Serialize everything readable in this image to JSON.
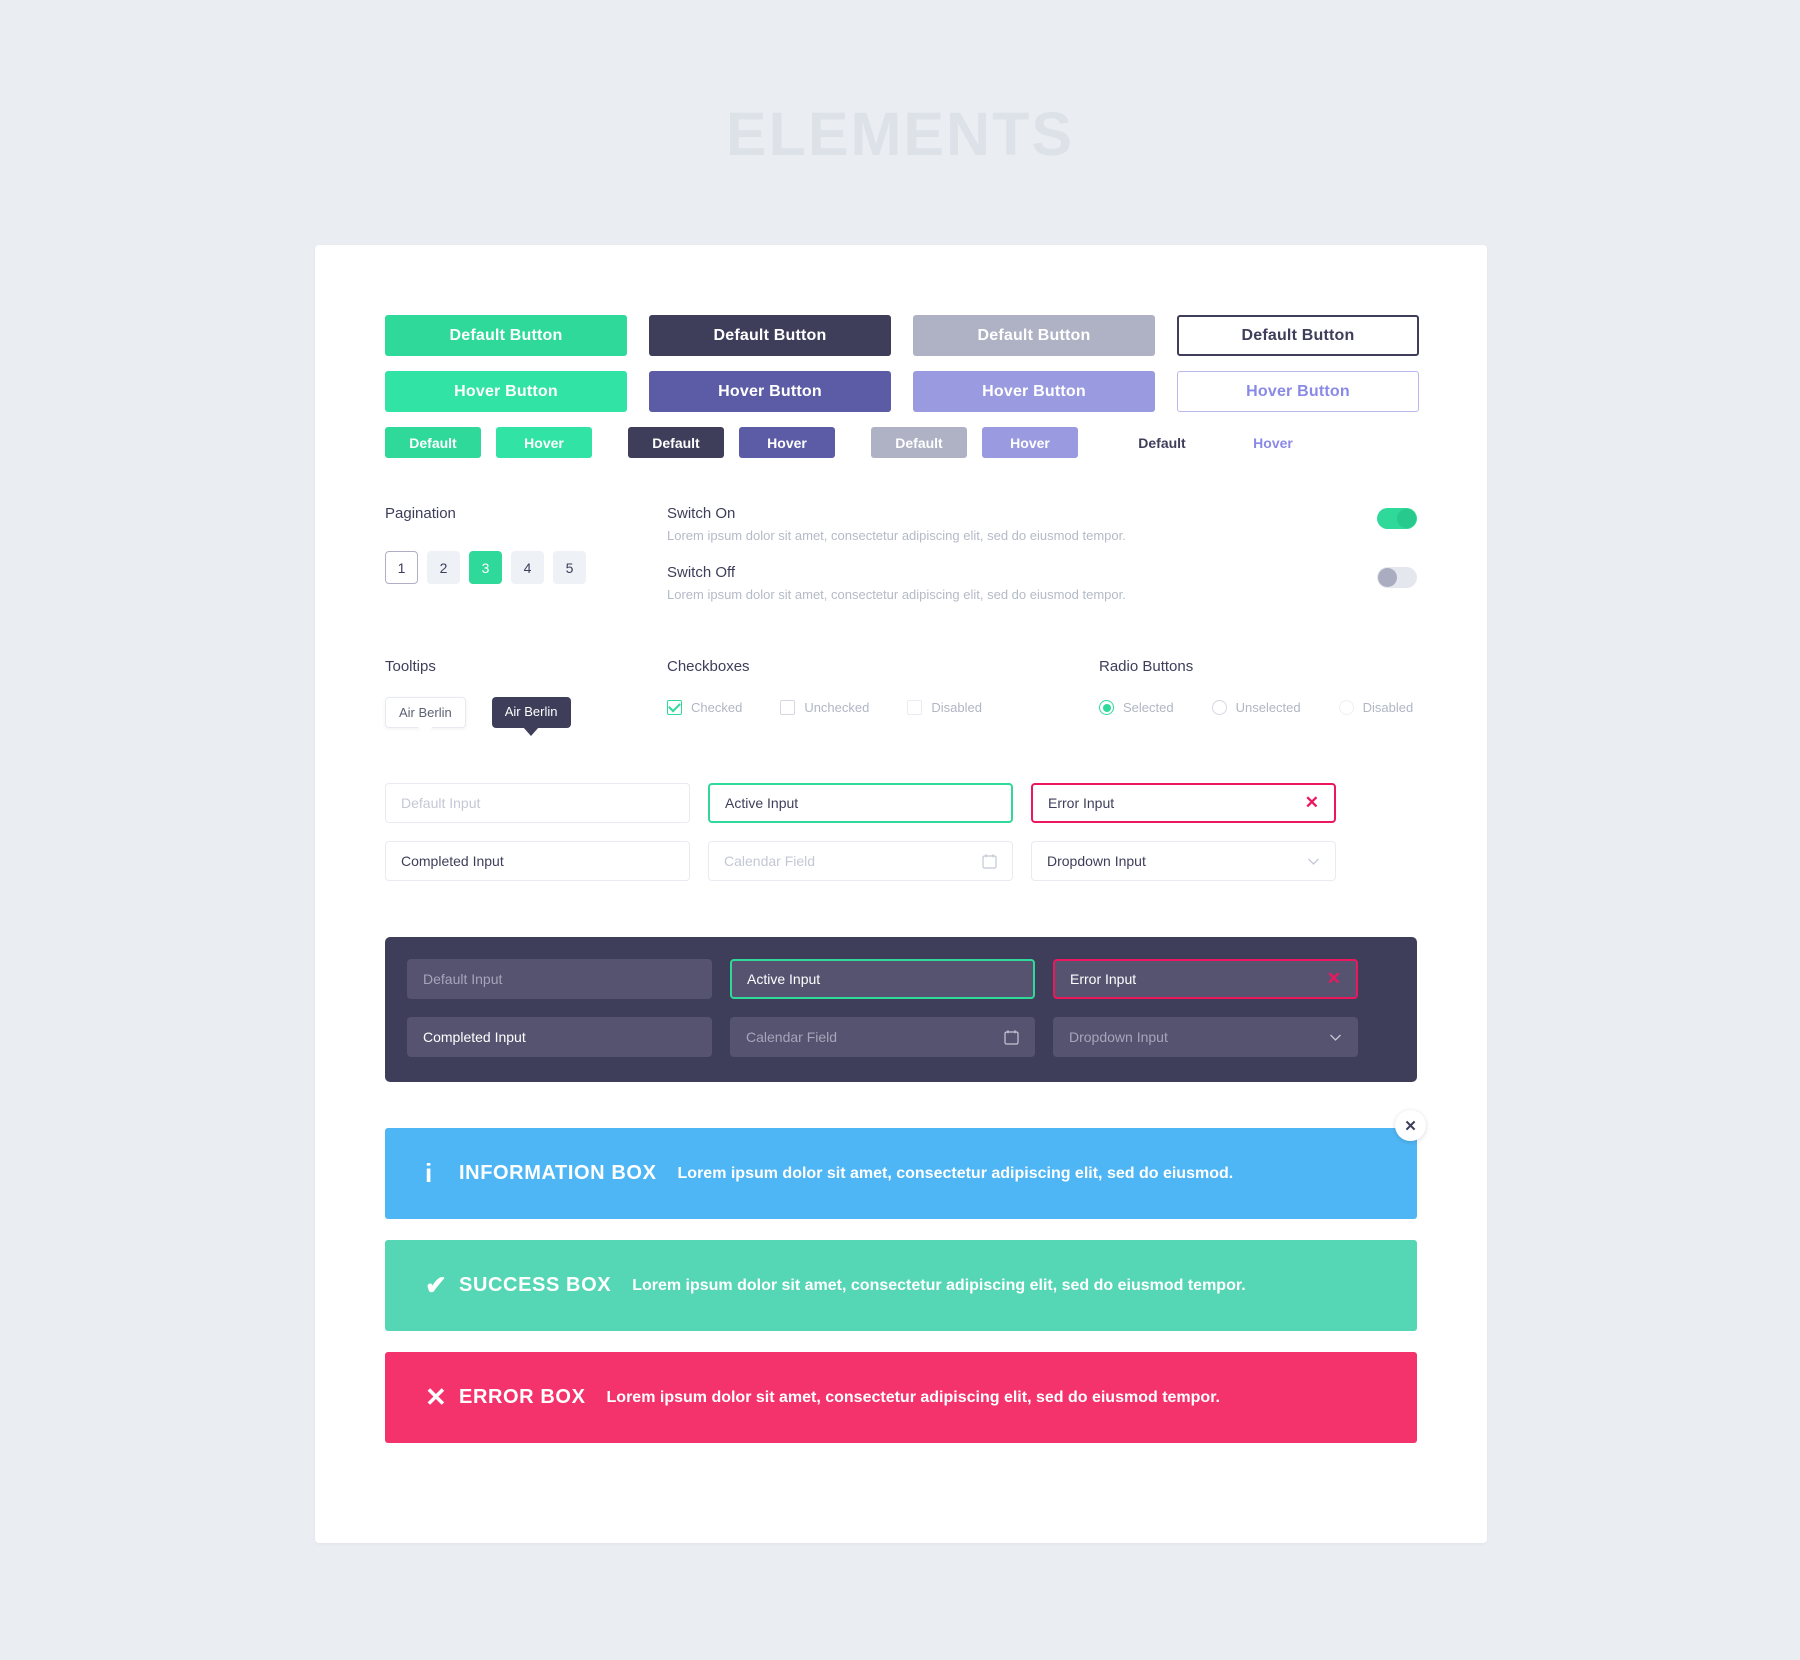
{
  "page": {
    "title": "ELEMENTS"
  },
  "buttons": {
    "large": [
      {
        "label": "Default Button",
        "style": "green"
      },
      {
        "label": "Default Button",
        "style": "dark"
      },
      {
        "label": "Default Button",
        "style": "gray"
      },
      {
        "label": "Default Button",
        "style": "outline-dark"
      }
    ],
    "hover": [
      {
        "label": "Hover Button",
        "style": "green-light"
      },
      {
        "label": "Hover Button",
        "style": "purple"
      },
      {
        "label": "Hover Button",
        "style": "light-purple"
      },
      {
        "label": "Hover Button",
        "style": "outline-purple"
      }
    ],
    "small": [
      {
        "label": "Default",
        "style": "green"
      },
      {
        "label": "Hover",
        "style": "green-light"
      },
      {
        "label": "Default",
        "style": "dark"
      },
      {
        "label": "Hover",
        "style": "purple"
      },
      {
        "label": "Default",
        "style": "gray"
      },
      {
        "label": "Hover",
        "style": "light-purple"
      },
      {
        "label": "Default",
        "style": "outline-dark"
      },
      {
        "label": "Hover",
        "style": "outline-purple"
      }
    ]
  },
  "pagination": {
    "label": "Pagination",
    "pages": [
      "1",
      "2",
      "3",
      "4",
      "5"
    ],
    "active_page": "3",
    "current_page": "1"
  },
  "switches": [
    {
      "title": "Switch On",
      "description": "Lorem ipsum dolor sit amet, consectetur adipiscing elit, sed do eiusmod tempor.",
      "state": "on"
    },
    {
      "title": "Switch Off",
      "description": "Lorem ipsum dolor sit amet, consectetur adipiscing elit, sed do eiusmod tempor.",
      "state": "off"
    }
  ],
  "tooltips": {
    "label": "Tooltips",
    "items": [
      {
        "text": "Air Berlin",
        "variant": "light"
      },
      {
        "text": "Air Berlin",
        "variant": "dark"
      }
    ]
  },
  "checkboxes": {
    "label": "Checkboxes",
    "items": [
      {
        "label": "Checked",
        "state": "checked"
      },
      {
        "label": "Unchecked",
        "state": "unchecked"
      },
      {
        "label": "Disabled",
        "state": "disabled"
      }
    ]
  },
  "radios": {
    "label": "Radio Buttons",
    "items": [
      {
        "label": "Selected",
        "state": "selected"
      },
      {
        "label": "Unselected",
        "state": "unselected"
      },
      {
        "label": "Disabled",
        "state": "disabled"
      }
    ]
  },
  "inputs_light": [
    {
      "value": "",
      "placeholder": "Default Input",
      "state": "default"
    },
    {
      "value": "Active Input",
      "placeholder": "",
      "state": "active"
    },
    {
      "value": "Error Input",
      "placeholder": "",
      "state": "error",
      "icon": "x-icon"
    },
    {
      "value": "Completed Input",
      "placeholder": "",
      "state": "completed"
    },
    {
      "value": "",
      "placeholder": "Calendar Field",
      "state": "calendar",
      "icon": "calendar-icon"
    },
    {
      "value": "Dropdown Input",
      "placeholder": "",
      "state": "dropdown",
      "icon": "chevron-down-icon"
    }
  ],
  "inputs_dark": [
    {
      "value": "",
      "placeholder": "Default Input",
      "state": "default"
    },
    {
      "value": "Active Input",
      "placeholder": "",
      "state": "active"
    },
    {
      "value": "Error Input",
      "placeholder": "",
      "state": "error",
      "icon": "x-icon"
    },
    {
      "value": "Completed Input",
      "placeholder": "",
      "state": "completed"
    },
    {
      "value": "",
      "placeholder": "Calendar Field",
      "state": "calendar",
      "icon": "calendar-icon"
    },
    {
      "value": "Dropdown Input",
      "placeholder": "",
      "state": "dropdown",
      "icon": "chevron-down-icon"
    }
  ],
  "alerts": {
    "close_label": "✕",
    "items": [
      {
        "icon": "info-icon",
        "glyph": "i",
        "title": "INFORMATION BOX",
        "text": "Lorem ipsum dolor sit amet, consectetur adipiscing elit, sed do eiusmod.",
        "type": "info"
      },
      {
        "icon": "check-icon",
        "glyph": "✔",
        "title": "SUCCESS BOX",
        "text": "Lorem ipsum dolor sit amet, consectetur adipiscing elit, sed do eiusmod tempor.",
        "type": "success"
      },
      {
        "icon": "cross-icon",
        "glyph": "✕",
        "title": "ERROR BOX",
        "text": "Lorem ipsum dolor sit amet, consectetur adipiscing elit, sed do eiusmod tempor.",
        "type": "error"
      }
    ]
  },
  "colors": {
    "green": "#2FD99A",
    "dark": "#3E3E5B",
    "gray": "#AEB2C4",
    "purple": "#5C5CA6",
    "light_purple": "#9A9AE0",
    "error": "#ED175E",
    "info": "#4FB6F5",
    "success": "#55D6B5",
    "error_box": "#F4336D",
    "background": "#EAEEF2"
  }
}
